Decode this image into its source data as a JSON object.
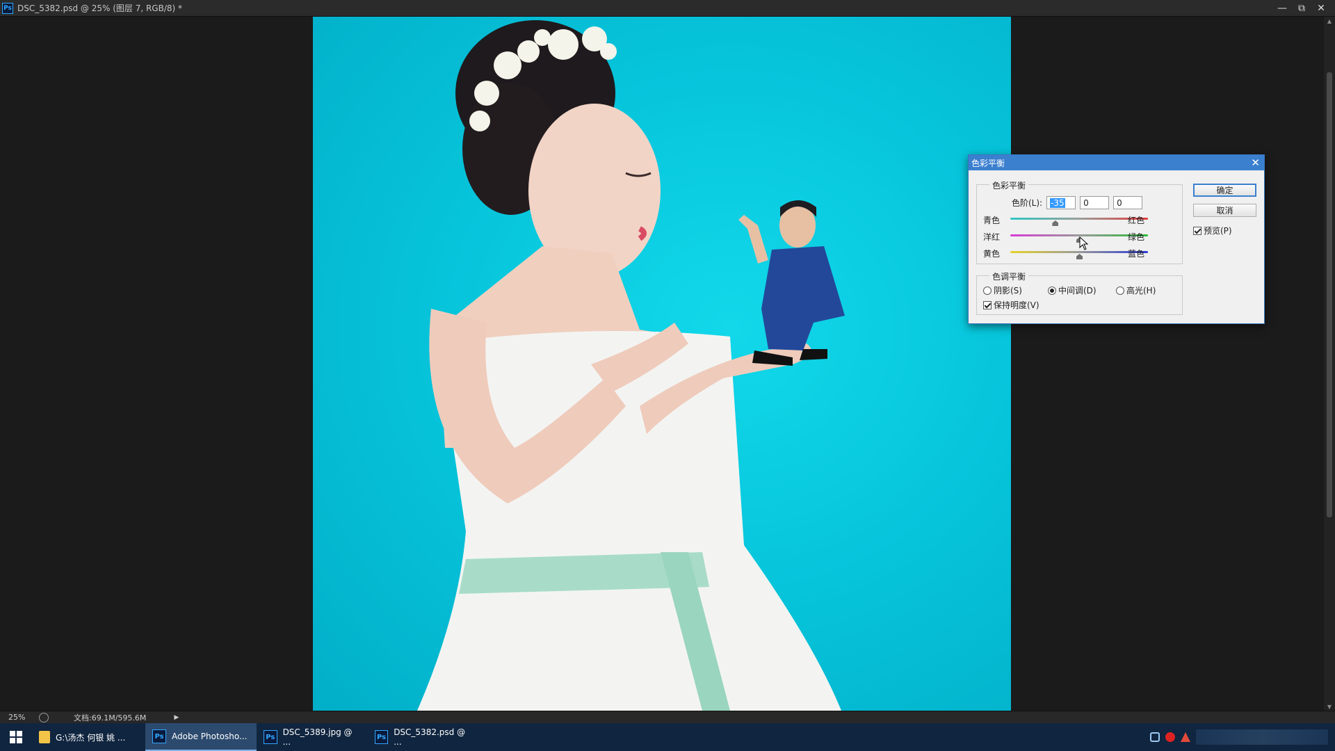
{
  "window": {
    "title": "DSC_5382.psd @ 25% (图层 7, RGB/8) *",
    "app_icon": "Ps"
  },
  "dialog": {
    "title": "色彩平衡",
    "color_balance_group": "色彩平衡",
    "levels_label": "色阶(L):",
    "levels": [
      "-35",
      "0",
      "0"
    ],
    "sliders": [
      {
        "left": "青色",
        "right": "红色",
        "value": -35
      },
      {
        "left": "洋红",
        "right": "绿色",
        "value": 0
      },
      {
        "left": "黄色",
        "right": "蓝色",
        "value": 0
      }
    ],
    "tone_group": "色调平衡",
    "tones": {
      "shadows": "阴影(S)",
      "midtones": "中间调(D)",
      "highlights": "高光(H)"
    },
    "selected_tone": "midtones",
    "preserve_luminosity": "保持明度(V)",
    "preserve_luminosity_checked": true,
    "ok": "确定",
    "cancel": "取消",
    "preview": "预览(P)",
    "preview_checked": true
  },
  "statusbar": {
    "zoom": "25%",
    "doc_info": "文档:69.1M/595.6M"
  },
  "taskbar": {
    "items": [
      {
        "label": "G:\\汤杰  何银  姚 ...",
        "icon": "folder-icon"
      },
      {
        "label": "Adobe Photosho...",
        "icon": "Ps"
      },
      {
        "label": "DSC_5389.jpg @ ...",
        "icon": "Ps"
      },
      {
        "label": "DSC_5382.psd @ ...",
        "icon": "Ps"
      }
    ]
  },
  "colors": {
    "canvas_bg": "#07c6dc",
    "dialog_title": "#3b7fcf",
    "taskbar": "#10253f"
  }
}
